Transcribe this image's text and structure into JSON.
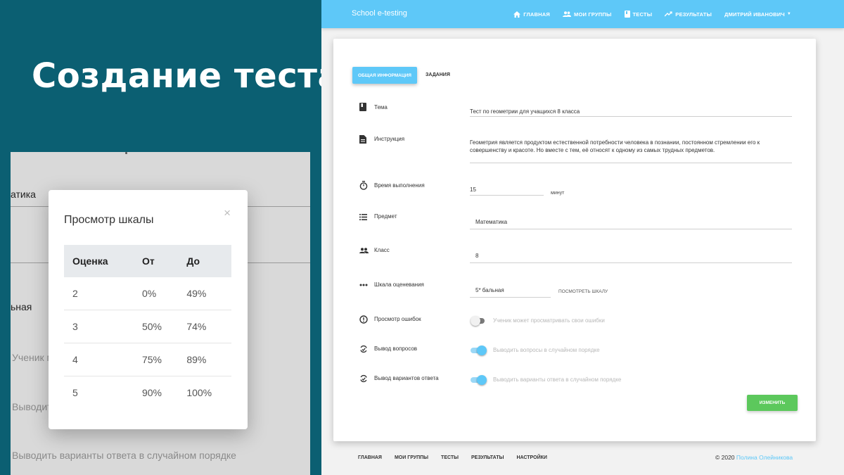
{
  "slide_title": "Создание теста",
  "zoom": {
    "bg_fragments": {
      "field1": "атика",
      "field2": "ьная",
      "toggle1_text": "Ученик м",
      "toggle2_text": "Выводит",
      "toggle3_text": "Выводить варианты ответа в случайном порядке"
    },
    "modal": {
      "title": "Просмотр шкалы",
      "close_glyph": "×",
      "columns": [
        "Оценка",
        "От",
        "До"
      ],
      "rows": [
        [
          "2",
          "0%",
          "49%"
        ],
        [
          "3",
          "50%",
          "74%"
        ],
        [
          "4",
          "75%",
          "89%"
        ],
        [
          "5",
          "90%",
          "100%"
        ]
      ]
    }
  },
  "app": {
    "brand": "School e-testing",
    "nav": [
      {
        "label": "Главная",
        "icon": "home-icon"
      },
      {
        "label": "Мои группы",
        "icon": "group-icon"
      },
      {
        "label": "Тесты",
        "icon": "book-icon"
      },
      {
        "label": "Результаты",
        "icon": "trending-up-icon"
      },
      {
        "label": "Дмитрий Иванович",
        "icon": "caret-down-icon"
      }
    ],
    "tabs": {
      "general": "Общая информация",
      "tasks": "Задания"
    },
    "form": {
      "topic": {
        "label": "Тема",
        "value": "Тест по геометрии для учащихся 8 класса"
      },
      "instruction": {
        "label": "Инструкция",
        "value": "Геометрия является продуктом естественной потребности человека в познании, постоянном стремлении его к совершенству и красоте. Но вместе с тем, её относят к одному из самых трудных предметов."
      },
      "duration": {
        "label": "Время выполнения",
        "value": "15",
        "unit": "минут"
      },
      "subject": {
        "label": "Предмет",
        "value": "Математика"
      },
      "grade": {
        "label": "Класс",
        "value": "8"
      },
      "scale": {
        "label": "Шкала оценевания",
        "value": "5* бальная",
        "link": "посмотреть шкалу"
      },
      "errors_view": {
        "label": "Просмотр ошибок",
        "text": "Ученик может просматривать свои ошибки",
        "on": false
      },
      "questions_order": {
        "label": "Вывод вопросов",
        "text": "Выводить вопросы в случайном порядке",
        "on": true
      },
      "answers_order": {
        "label": "Вывод вариантов ответа",
        "text": "Выводить варианты ответа в случайном порядке",
        "on": true
      }
    },
    "submit_label": "Изменить",
    "footer": {
      "links": [
        "Главная",
        "Мои группы",
        "Тесты",
        "Результаты",
        "Настройки"
      ],
      "copyright": "© 2020",
      "author": "Полина Олейникова"
    },
    "colors": {
      "accent": "#5ec8f8",
      "success": "#5cc85c",
      "slide_bg": "#0b5f72"
    }
  }
}
